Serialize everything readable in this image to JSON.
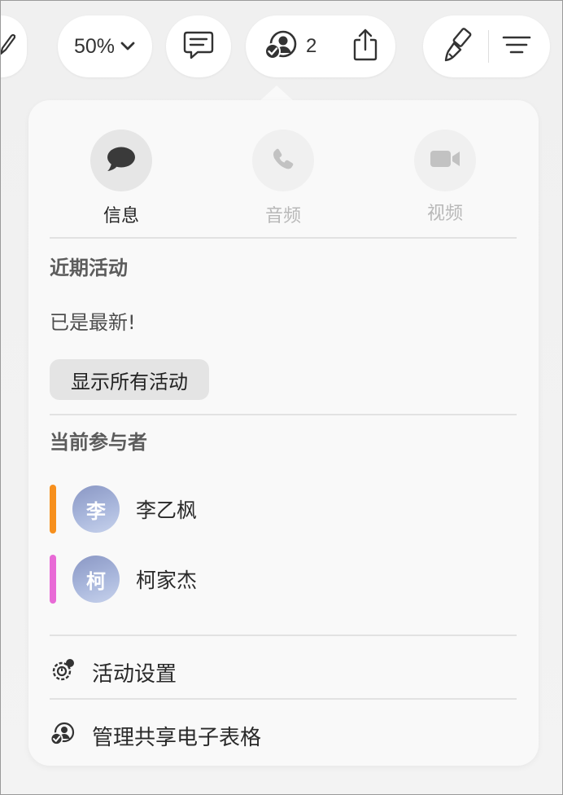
{
  "toolbar": {
    "zoom_value": "50%",
    "collaborator_count": "2"
  },
  "popover": {
    "communication": [
      {
        "label": "信息",
        "state": "active"
      },
      {
        "label": "音频",
        "state": "disabled"
      },
      {
        "label": "视频",
        "state": "disabled"
      }
    ],
    "recent_activity": {
      "title": "近期活动",
      "status": "已是最新!",
      "show_all_label": "显示所有活动"
    },
    "participants_section": {
      "title": "当前参与者",
      "participants": [
        {
          "initial": "李",
          "name": "李乙枫",
          "color": "#f7901e"
        },
        {
          "initial": "柯",
          "name": "柯家杰",
          "color": "#e86ad6"
        }
      ]
    },
    "menu": {
      "activity_settings": "活动设置",
      "manage_sharing": "管理共享电子表格"
    }
  },
  "colors": {
    "active_icon_bg": "#e6e6e6",
    "disabled_icon_bg": "#f0f0f0",
    "active_text": "#222222",
    "disabled_text": "#b8b8b8"
  }
}
